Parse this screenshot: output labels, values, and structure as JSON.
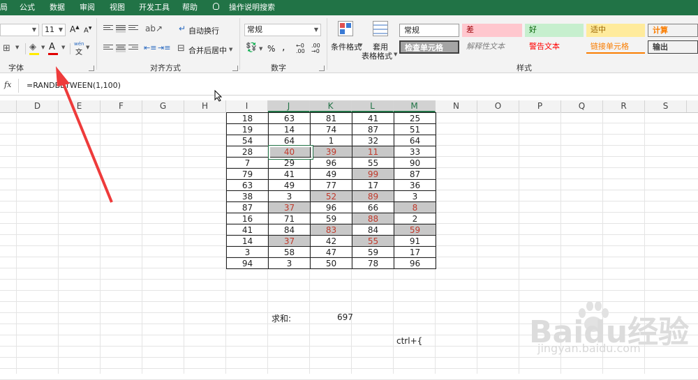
{
  "menu": {
    "items": [
      "局",
      "公式",
      "数据",
      "审阅",
      "视图",
      "开发工具",
      "帮助"
    ],
    "tell_me": "操作说明搜索"
  },
  "ribbon": {
    "font": {
      "size": "11",
      "grow": "A",
      "shrink": "A",
      "group_label": "字体",
      "font_color_label": "A",
      "wen": "wén",
      "wen_char": "文"
    },
    "alignment": {
      "wrap_text": "自动换行",
      "merge_center": "合并后居中",
      "group_label": "对齐方式"
    },
    "number": {
      "format": "常规",
      "percent": "%",
      "comma": ",",
      "inc_decimal": "←0 .00",
      "dec_decimal": ".00 →0",
      "group_label": "数字"
    },
    "styles": {
      "conditional": "条件格式",
      "table_format_1": "套用",
      "table_format_2": "表格格式",
      "group_label": "样式",
      "cells": [
        {
          "label": "常规",
          "bg": "#ffffff",
          "color": "#222222"
        },
        {
          "label": "差",
          "bg": "#ffc7ce",
          "color": "#9c0006"
        },
        {
          "label": "好",
          "bg": "#c6efce",
          "color": "#006100"
        },
        {
          "label": "适中",
          "bg": "#ffeb9c",
          "color": "#9c6500"
        },
        {
          "label": "计算",
          "bg": "#f2f2f2",
          "color": "#fa7d00"
        },
        {
          "label": "检查单元格",
          "bg": "#a5a5a5",
          "color": "#ffffff"
        },
        {
          "label": "解释性文本",
          "bg": "#ffffff",
          "color": "#7f7f7f"
        },
        {
          "label": "警告文本",
          "bg": "#ffffff",
          "color": "#ff0000"
        },
        {
          "label": "链接单元格",
          "bg": "#ffffff",
          "color": "#fa7d00"
        },
        {
          "label": "输出",
          "bg": "#f2f2f2",
          "color": "#3f3f3f"
        }
      ]
    }
  },
  "formula_bar": {
    "fx": "fx",
    "formula": "=RANDBETWEEN(1,100)"
  },
  "columns": [
    "D",
    "E",
    "F",
    "G",
    "H",
    "I",
    "J",
    "K",
    "L",
    "M",
    "N",
    "O",
    "P",
    "Q",
    "R",
    "S"
  ],
  "table": {
    "rows": [
      [
        "18",
        "63",
        "81",
        "41",
        "25"
      ],
      [
        "19",
        "14",
        "74",
        "87",
        "51"
      ],
      [
        "54",
        "64",
        "1",
        "32",
        "64"
      ],
      [
        "28",
        "40",
        "39",
        "11",
        "33"
      ],
      [
        "7",
        "29",
        "96",
        "55",
        "90"
      ],
      [
        "79",
        "41",
        "49",
        "99",
        "87"
      ],
      [
        "63",
        "49",
        "77",
        "17",
        "36"
      ],
      [
        "38",
        "3",
        "52",
        "89",
        "3"
      ],
      [
        "87",
        "37",
        "96",
        "66",
        "8"
      ],
      [
        "16",
        "71",
        "59",
        "88",
        "2"
      ],
      [
        "41",
        "84",
        "83",
        "84",
        "59"
      ],
      [
        "14",
        "37",
        "42",
        "55",
        "91"
      ],
      [
        "3",
        "58",
        "47",
        "59",
        "17"
      ],
      [
        "94",
        "3",
        "50",
        "78",
        "96"
      ]
    ],
    "highlighted": [
      "3-1",
      "3-2",
      "3-3",
      "5-3",
      "7-2",
      "7-3",
      "8-1",
      "8-4",
      "9-3",
      "10-2",
      "10-4",
      "11-1",
      "11-3"
    ]
  },
  "sum": {
    "label": "求和:",
    "value": "697"
  },
  "shortcut_note": "ctrl+{",
  "watermark": {
    "logo": "Baidu经验",
    "url": "jingyan.baidu.com"
  },
  "colors": {
    "excel_green": "#217346",
    "highlight_red": "#c0392b",
    "arrow": "#ee3b3b",
    "selected_fill": "#c8c8c8"
  }
}
